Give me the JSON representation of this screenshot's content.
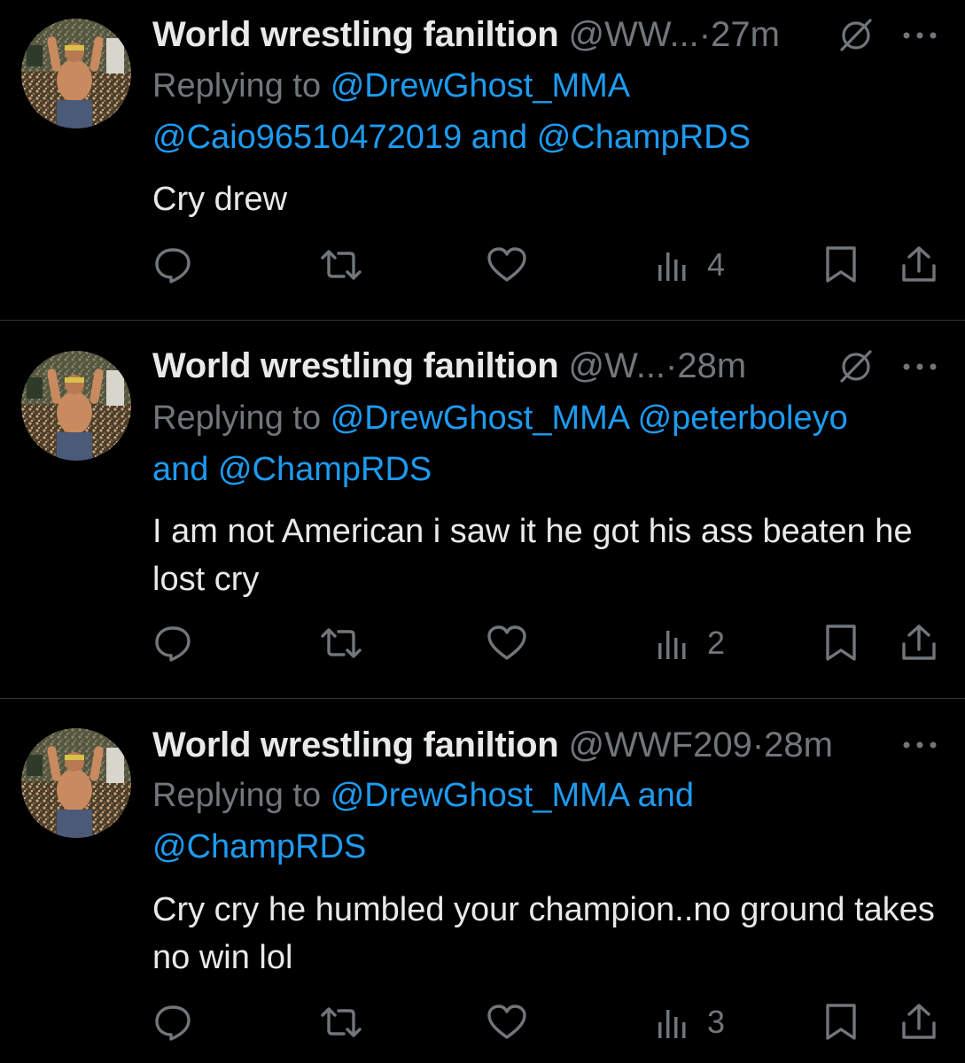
{
  "colors": {
    "background": "#000000",
    "text": "#e7e9ea",
    "muted": "#71767b",
    "link": "#1d9bf0",
    "divider": "#2f3336"
  },
  "tweets": [
    {
      "display_name": "World wrestling faniltion",
      "handle": "@WW...",
      "dot": "·",
      "time": "27m",
      "replying_label": "Replying to",
      "mentions_line": [
        "@DrewGhost_MMA",
        "@Caio96510472019",
        "@ChampRDS"
      ],
      "and_word": "and",
      "text": "Cry drew",
      "views": "4",
      "icons": [
        "mute-icon",
        "more-icon",
        "reply-icon",
        "retweet-icon",
        "like-icon",
        "views-icon",
        "bookmark-icon",
        "share-icon"
      ]
    },
    {
      "display_name": "World wrestling faniltion",
      "handle": "@W...",
      "dot": "·",
      "time": "28m",
      "replying_label": "Replying to",
      "mentions_line": [
        "@DrewGhost_MMA",
        "@peterboleyo",
        "@ChampRDS"
      ],
      "and_word": "and",
      "text": "I am not American i saw it he got his ass beaten he lost cry",
      "views": "2",
      "icons": [
        "mute-icon",
        "more-icon",
        "reply-icon",
        "retweet-icon",
        "like-icon",
        "views-icon",
        "bookmark-icon",
        "share-icon"
      ]
    },
    {
      "display_name": "World wrestling faniltion",
      "handle": "@WWF209",
      "dot": "·",
      "time": "28m",
      "replying_label": "Replying to",
      "mentions_line": [
        "@DrewGhost_MMA",
        "@ChampRDS"
      ],
      "and_word": "and",
      "text": "Cry cry he humbled your champion..no ground takes no win lol",
      "views": "3",
      "icons": [
        "more-icon",
        "reply-icon",
        "retweet-icon",
        "like-icon",
        "views-icon",
        "bookmark-icon",
        "share-icon"
      ]
    }
  ]
}
